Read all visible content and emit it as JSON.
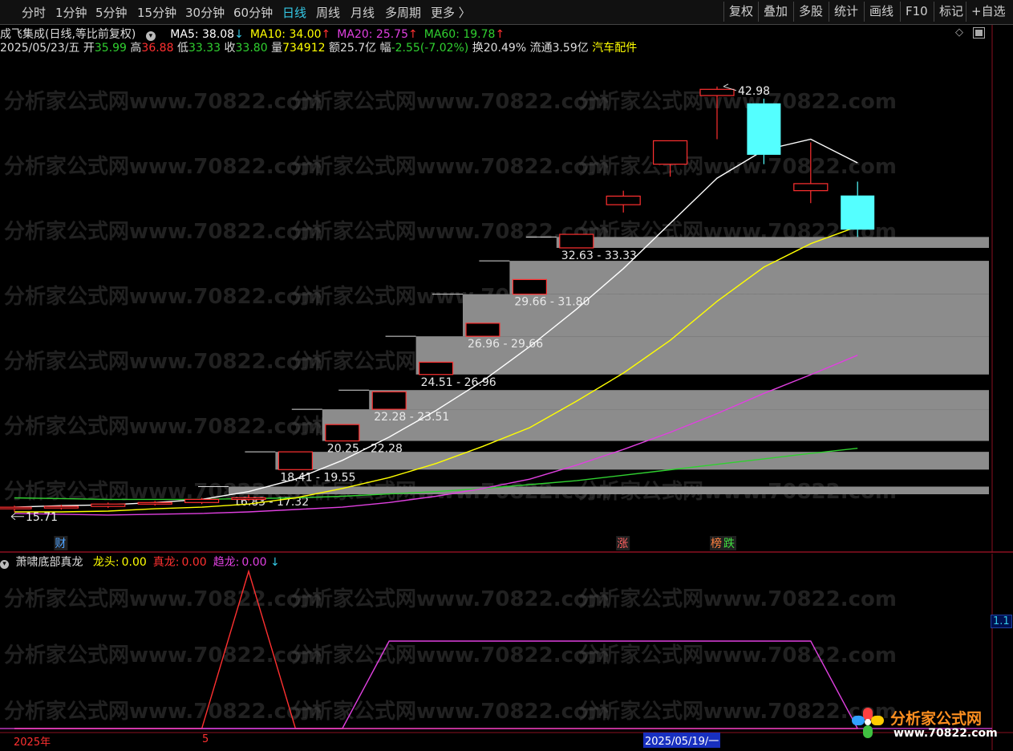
{
  "toolbar": {
    "left_items": [
      {
        "label": "分时",
        "active": false
      },
      {
        "label": "1分钟",
        "active": false
      },
      {
        "label": "5分钟",
        "active": false
      },
      {
        "label": "15分钟",
        "active": false
      },
      {
        "label": "30分钟",
        "active": false
      },
      {
        "label": "60分钟",
        "active": false
      },
      {
        "label": "日线",
        "active": true
      },
      {
        "label": "周线",
        "active": false
      },
      {
        "label": "月线",
        "active": false
      },
      {
        "label": "多周期",
        "active": false
      },
      {
        "label": "更多 〉",
        "active": false
      }
    ],
    "right_items": [
      "复权",
      "叠加",
      "多股",
      "统计",
      "画线",
      "F10",
      "标记",
      "+自选"
    ]
  },
  "header": {
    "title": "成飞集成(日线,等比前复权)",
    "ma": [
      {
        "label": "MA5: 38.08",
        "arrow": "↓",
        "color": "#ffffff",
        "arrow_color": "#35c9e6"
      },
      {
        "label": "MA10: 34.00",
        "arrow": "↑",
        "color": "#ffff00",
        "arrow_color": "#ff3030"
      },
      {
        "label": "MA20: 25.75",
        "arrow": "↑",
        "color": "#e040e0",
        "arrow_color": "#ff3030"
      },
      {
        "label": "MA60: 19.78",
        "arrow": "↑",
        "color": "#30d030",
        "arrow_color": "#ff3030"
      }
    ],
    "date": "2025/05/23/五",
    "open_label": "开",
    "open": "35.99",
    "high_label": "高",
    "high": "36.88",
    "low_label": "低",
    "low": "33.33",
    "close_label": "收",
    "close": "33.80",
    "vol_label": "量",
    "vol": "734912",
    "amount": "额25.7亿",
    "change_label": "幅",
    "change": "-2.55(-7.02%)",
    "turnover": "换20.49%",
    "float": "流通3.59亿",
    "sector": "汽车配件"
  },
  "colors": {
    "up": "#ff3030",
    "down": "#54ffff",
    "ma5": "#ffffff",
    "ma10": "#ffff00",
    "ma20": "#e040e0",
    "ma60": "#30d030",
    "zone": "#8c8c8c"
  },
  "chart_data": {
    "type": "candlestick",
    "price_range": [
      14,
      44
    ],
    "candles": [
      {
        "o": 15.9,
        "h": 16.1,
        "l": 15.71,
        "c": 16.0
      },
      {
        "o": 16.0,
        "h": 16.15,
        "l": 15.85,
        "c": 16.05
      },
      {
        "o": 16.05,
        "h": 16.3,
        "l": 15.95,
        "c": 16.2
      },
      {
        "o": 16.2,
        "h": 16.4,
        "l": 16.1,
        "c": 16.3
      },
      {
        "o": 16.3,
        "h": 16.6,
        "l": 16.2,
        "c": 16.5
      },
      {
        "o": 16.5,
        "h": 16.8,
        "l": 16.4,
        "c": 16.6
      },
      {
        "o": 18.41,
        "h": 19.55,
        "l": 18.41,
        "c": 19.55
      },
      {
        "o": 20.25,
        "h": 21.3,
        "l": 20.25,
        "c": 21.3
      },
      {
        "o": 22.28,
        "h": 23.4,
        "l": 22.28,
        "c": 23.4
      },
      {
        "o": 24.51,
        "h": 25.3,
        "l": 24.51,
        "c": 25.3
      },
      {
        "o": 26.96,
        "h": 27.8,
        "l": 26.96,
        "c": 27.8
      },
      {
        "o": 29.66,
        "h": 30.6,
        "l": 29.66,
        "c": 30.6
      },
      {
        "o": 32.63,
        "h": 33.5,
        "l": 32.63,
        "c": 33.5
      },
      {
        "o": 35.4,
        "h": 36.3,
        "l": 34.9,
        "c": 35.95
      },
      {
        "o": 38.0,
        "h": 39.5,
        "l": 37.2,
        "c": 39.5
      },
      {
        "o": 42.4,
        "h": 42.98,
        "l": 39.6,
        "c": 42.8
      },
      {
        "o": 41.9,
        "h": 42.2,
        "l": 38.0,
        "c": 38.6
      },
      {
        "o": 36.3,
        "h": 39.4,
        "l": 35.5,
        "c": 36.75
      },
      {
        "o": 35.99,
        "h": 36.88,
        "l": 33.33,
        "c": 33.8
      }
    ],
    "ma5": [
      16.0,
      16.1,
      16.15,
      16.3,
      16.5,
      17.0,
      17.8,
      19.0,
      20.5,
      22.2,
      24.1,
      26.3,
      28.7,
      31.3,
      34.2,
      37.1,
      38.9,
      39.6,
      38.08
    ],
    "ma10": [
      15.7,
      15.7,
      15.75,
      15.9,
      16.0,
      16.2,
      16.6,
      17.2,
      17.9,
      18.8,
      19.9,
      21.1,
      22.8,
      24.6,
      26.7,
      29.2,
      31.4,
      32.9,
      34.0
    ],
    "ma20": [
      15.6,
      15.55,
      15.5,
      15.55,
      15.6,
      15.7,
      15.85,
      16.0,
      16.3,
      16.7,
      17.2,
      17.8,
      18.7,
      19.7,
      20.8,
      22.0,
      23.3,
      24.5,
      25.75
    ],
    "ma60": [
      16.6,
      16.55,
      16.5,
      16.5,
      16.5,
      16.55,
      16.6,
      16.7,
      16.85,
      17.0,
      17.2,
      17.45,
      17.7,
      18.05,
      18.4,
      18.75,
      19.1,
      19.45,
      19.78
    ],
    "zones": [
      {
        "label": "16.83 - 17.32",
        "low": 16.83,
        "high": 17.32,
        "start": 5
      },
      {
        "label": "18.41 - 19.55",
        "low": 18.41,
        "high": 19.55,
        "start": 6
      },
      {
        "label": "20.25 - 22.28",
        "low": 20.25,
        "high": 22.28,
        "start": 7
      },
      {
        "label": "22.28 - 23.51",
        "low": 22.28,
        "high": 23.51,
        "start": 8
      },
      {
        "label": "24.51 - 26.96",
        "low": 24.51,
        "high": 26.96,
        "start": 9
      },
      {
        "label": "26.96 - 29.66",
        "low": 26.96,
        "high": 29.66,
        "start": 10
      },
      {
        "label": "29.66 - 31.80",
        "low": 29.66,
        "high": 31.8,
        "start": 11
      },
      {
        "label": "32.63 - 33.33",
        "low": 32.63,
        "high": 33.33,
        "start": 12
      }
    ],
    "high_marker": "42.98",
    "low_marker": "15.71",
    "events": [
      {
        "label": "财",
        "index": 1,
        "color": "#4fa3ff"
      },
      {
        "label": "涨",
        "index": 13,
        "color": "#ff6060"
      },
      {
        "label": "榜",
        "index": 15,
        "color": "#ff8040"
      },
      {
        "label": "跌",
        "index": 15,
        "color": "#40e040"
      }
    ]
  },
  "indicator": {
    "name": "萧啸底部真龙",
    "items": [
      {
        "label": "龙头:",
        "value": "0.00",
        "label_color": "#ffff00",
        "value_color": "#ffff00"
      },
      {
        "label": "真龙:",
        "value": "0.00",
        "label_color": "#ff3030",
        "value_color": "#ff3030"
      },
      {
        "label": "趋龙:",
        "value": "0.00",
        "label_color": "#e040e0",
        "value_color": "#e040e0"
      }
    ],
    "arrow": "↓",
    "right_value": "1.1",
    "zhenlong": [
      0,
      0,
      0,
      0,
      0,
      1,
      0,
      0,
      0,
      0,
      0,
      0,
      0,
      0,
      0,
      0,
      0,
      0,
      0
    ],
    "qulong": [
      0,
      0,
      0,
      0,
      0,
      0,
      0,
      0,
      1,
      1,
      1,
      1,
      1,
      1,
      1,
      1,
      1,
      1,
      0
    ]
  },
  "date_axis": {
    "year": "2025年",
    "month": "5",
    "cursor_date": "2025/05/19/一"
  },
  "watermark": {
    "text": "分析家公式网www.70822.com",
    "logo_name": "分析家公式网",
    "logo_url": "www.70822.com"
  }
}
